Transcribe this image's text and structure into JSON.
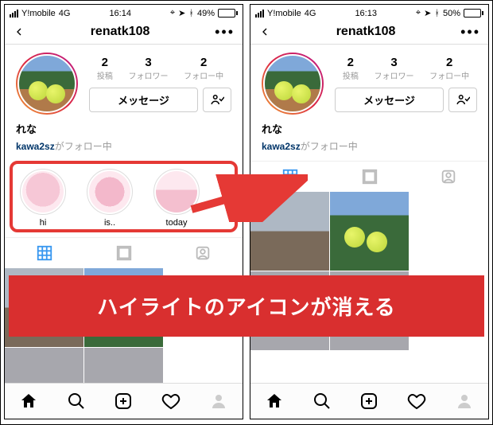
{
  "banner_text": "ハイライトのアイコンが消える",
  "status_left": {
    "carrier": "Y!mobile",
    "net": "4G",
    "time": "16:14",
    "batt_pct": "49%",
    "batt_fill_pct": 49
  },
  "status_right": {
    "carrier": "Y!mobile",
    "net": "4G",
    "time": "16:13",
    "batt_pct": "50%",
    "batt_fill_pct": 50
  },
  "nav": {
    "username": "renatk108"
  },
  "stats": {
    "posts": {
      "num": "2",
      "label": "投稿"
    },
    "followers": {
      "num": "3",
      "label": "フォロワー"
    },
    "following": {
      "num": "2",
      "label": "フォロー中"
    }
  },
  "buttons": {
    "message": "メッセージ"
  },
  "bio": {
    "display_name": "れな"
  },
  "followed_by": {
    "user": "kawa2sz",
    "suffix": "がフォロー中"
  },
  "highlights": [
    {
      "label": "hi",
      "bg": "radial-gradient(circle at 50% 45%, #f6c7d6 0 55%, #fde8ef 55% 100%)"
    },
    {
      "label": "is..",
      "bg": "radial-gradient(circle at 50% 50%, #f3b8cb 0 50%, #fde8ef 50% 100%)"
    },
    {
      "label": "today",
      "bg": "linear-gradient(180deg,#fde8ef 0 45%,#f4bfcf 45% 100%)"
    }
  ]
}
